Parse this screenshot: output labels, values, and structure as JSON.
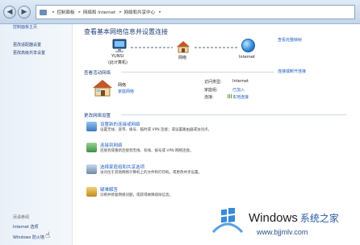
{
  "address_bar": {
    "crumbs": [
      "控制面板",
      "网络和 Internet",
      "网络和共享中心"
    ],
    "separator": "▸"
  },
  "sidebar": {
    "home": "控制面板主页",
    "items": [
      {
        "label": "更改适配器设置"
      },
      {
        "label": "更改高级共享设置"
      }
    ],
    "see_also_title": "另请参阅",
    "see_also": [
      {
        "label": "Internet 选项"
      },
      {
        "label": "Windows 防火墙"
      }
    ]
  },
  "main": {
    "title": "查看基本网络信息并设置连接",
    "full_map_link": "查看完整映射",
    "map": {
      "computer_name": "YUNSI",
      "computer_sub": "(此计算机)",
      "network_label": "网络",
      "internet_label": "Internet"
    },
    "active_section": {
      "title": "查看活动网络",
      "connect_link": "连接或断开连接",
      "network_name": "网络",
      "network_type": "家庭网络",
      "access_type_label": "访问类型:",
      "access_type_value": "Internet",
      "homegroup_label": "家庭组:",
      "homegroup_value": "已加入",
      "connections_label": "连接:",
      "connections_value": "本地连接"
    },
    "change_section": {
      "title": "更改网络设置",
      "tasks": [
        {
          "title": "设置新的连接或网络",
          "desc": "设置无线、宽带、拨号、临时或 VPN 连接；或设置路由器或访问点。"
        },
        {
          "title": "连接到网络",
          "desc": "连接到或重新连接到无线、有线、拨号或 VPN 网络连接。"
        },
        {
          "title": "选择家庭组和共享选项",
          "desc": "访问位于其他网络计算机上的文件和打印机，或更改共享设置。"
        },
        {
          "title": "疑难解答",
          "desc": "诊断并修复网络问题，或获得故障排除信息。"
        }
      ]
    }
  },
  "watermark": {
    "brand": "Windows",
    "brand_cn": "系统之家",
    "url": "www.bjjmlv.com"
  },
  "colors": {
    "link": "#1f5ec6",
    "heading": "#1e3f7a",
    "sidebar_bg": "#e9f0f8"
  }
}
